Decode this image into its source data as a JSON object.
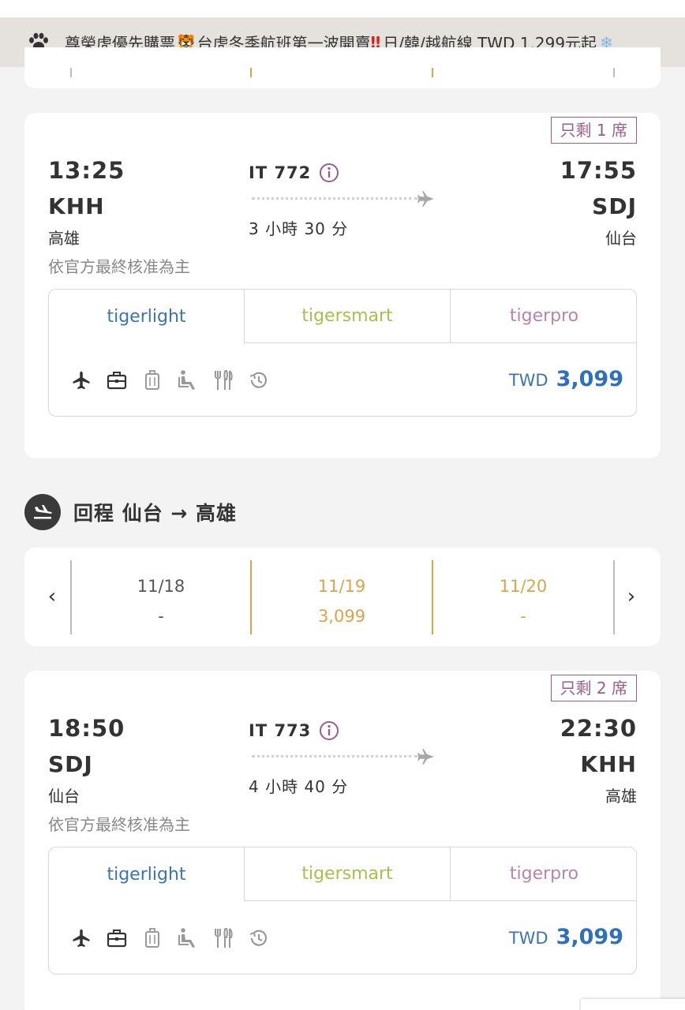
{
  "banner": {
    "text_part1": "尊榮虎優先購票",
    "emoji_tiger": "🐯",
    "text_part2": "台虎冬季航班第一波開賣",
    "emoji_alert": "‼",
    "text_part3": "日/韓/越航線 TWD 1,299元起",
    "emoji_snow": "❄",
    "icon": "paw-icon"
  },
  "outbound_flight": {
    "seats_left": "只剩 1 席",
    "depart_time": "13:25",
    "depart_code": "KHH",
    "depart_city": "高雄",
    "note": "依官方最終核准為主",
    "flight_no": "IT 772",
    "duration": "3 小時 30 分",
    "arrive_time": "17:55",
    "arrive_code": "SDJ",
    "arrive_city": "仙台",
    "fares": {
      "tab1": "tigerlight",
      "tab2": "tigersmart",
      "tab3": "tigerpro",
      "currency": "TWD",
      "price": "3,099"
    }
  },
  "return_section": {
    "title": "回程  仙台 → 高雄",
    "icon": "plane-landing-icon"
  },
  "return_dates": {
    "prev_label": "‹",
    "next_label": "›",
    "dates": [
      {
        "date": "11/18",
        "price": "-"
      },
      {
        "date": "11/19",
        "price": "3,099"
      },
      {
        "date": "11/20",
        "price": "-"
      }
    ]
  },
  "return_flight": {
    "seats_left": "只剩 2 席",
    "depart_time": "18:50",
    "depart_code": "SDJ",
    "depart_city": "仙台",
    "note": "依官方最終核准為主",
    "flight_no": "IT 773",
    "duration": "4 小時 40 分",
    "arrive_time": "22:30",
    "arrive_code": "KHH",
    "arrive_city": "高雄",
    "fares": {
      "tab1": "tigerlight",
      "tab2": "tigersmart",
      "tab3": "tigerpro",
      "currency": "TWD",
      "price": "3,099"
    }
  },
  "fare_icons": [
    "plane-icon",
    "briefcase-icon",
    "luggage-icon",
    "seat-icon",
    "meal-icon",
    "history-icon"
  ],
  "colors": {
    "brand_blue": "#3a74b4",
    "smart_green": "#a6c14a",
    "pro_mauve": "#b785a8",
    "date_gold": "#dba449",
    "seats_badge": "#9a5d8a"
  }
}
